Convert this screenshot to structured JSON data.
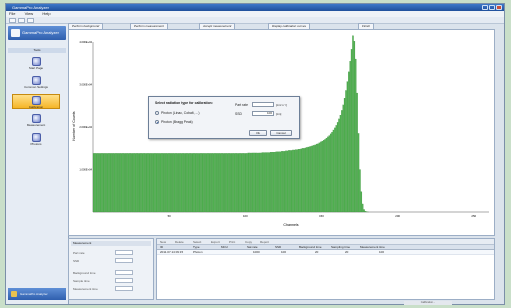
{
  "window": {
    "title": "GammaPro Analyzer"
  },
  "menu": [
    "File",
    "View",
    "Help"
  ],
  "sidebar": {
    "header": "GammaPro Analyzer",
    "tools_label": "Tools",
    "items": [
      {
        "label": "Start Page"
      },
      {
        "label": "Common Settings"
      },
      {
        "label": "Calibration"
      },
      {
        "label": "Measurement"
      },
      {
        "label": "Photons"
      }
    ],
    "active_index": 2,
    "footer": "GammaPro Analyzer"
  },
  "tabs": [
    "Perform background",
    "Perform measurement",
    "Accept measurement",
    "Display calibration curves",
    "Finish"
  ],
  "dialog": {
    "title": "Select radiation type for calibration:",
    "options": [
      "Photon (Linac, Cobalt, ...)",
      "Photon (Bragg Peak)"
    ],
    "selected_index": 1,
    "fields": [
      {
        "label": "Part rate",
        "value": "",
        "unit": "[cm² s⁻¹]"
      },
      {
        "label": "SSD",
        "value": "100",
        "unit": "[cm]"
      }
    ],
    "ok": "Ok",
    "cancel": "Cancel"
  },
  "chart_data": {
    "type": "bar",
    "ylabel": "Number of Counts",
    "xlabel": "Channels",
    "xlim": [
      0,
      260
    ],
    "x_ticks": [
      "50",
      "100",
      "150",
      "200",
      "250"
    ],
    "y_ticks": [
      "4.000E+04",
      "3.000E+04",
      "2.000E+04",
      "1.000E+04"
    ],
    "ylim": [
      0,
      40000
    ],
    "series": [
      {
        "values": [
          13800,
          13800,
          13800,
          13800,
          13800,
          13800,
          13800,
          13800,
          13800,
          13800,
          13800,
          13800,
          13800,
          13800,
          13800,
          13800,
          13800,
          13800,
          13800,
          13800,
          13800,
          13800,
          13800,
          13800,
          13800,
          13800,
          13800,
          13800,
          13800,
          13800,
          13800,
          13800,
          13800,
          13800,
          13800,
          13800,
          13800,
          13800,
          13800,
          13800,
          13800,
          13800,
          13800,
          13800,
          13800,
          13800,
          13800,
          13800,
          13800,
          13800,
          13800,
          13800,
          13800,
          13800,
          13800,
          13800,
          13800,
          13800,
          13800,
          13800,
          13800,
          13800,
          13800,
          13800,
          13800,
          13800,
          13800,
          13800,
          13800,
          13800,
          13800,
          13800,
          13800,
          13800,
          13800,
          13800,
          13800,
          13800,
          13800,
          13800,
          13800,
          13800,
          13800,
          13800,
          13800,
          13800,
          13800,
          13800,
          13800,
          13800,
          13800,
          13800,
          13800,
          13800,
          13800,
          13800,
          13800,
          13800,
          13800,
          13800,
          13800,
          13800,
          13800,
          13800,
          13800,
          13800,
          13800,
          13800,
          13800,
          13800,
          13800,
          13900,
          13900,
          13900,
          13900,
          13900,
          13900,
          13900,
          13900,
          13900,
          13900,
          14000,
          14000,
          14000,
          14000,
          14000,
          14000,
          14100,
          14100,
          14100,
          14100,
          14200,
          14200,
          14200,
          14200,
          14300,
          14300,
          14300,
          14400,
          14400,
          14500,
          14500,
          14500,
          14600,
          14600,
          14700,
          14700,
          14800,
          14800,
          14900,
          15000,
          15000,
          15100,
          15200,
          15300,
          15400,
          15500,
          15600,
          15700,
          15800,
          16000,
          16100,
          16300,
          16500,
          16700,
          16900,
          17100,
          17400,
          17700,
          18000,
          18400,
          18800,
          19300,
          19800,
          20400,
          21100,
          21900,
          22800,
          23900,
          25200,
          26800,
          28600,
          30700,
          33000,
          35500,
          38300,
          41500,
          40200,
          36000,
          28000,
          18500,
          10000,
          4800,
          1900,
          600,
          200,
          50,
          10,
          0,
          0,
          0,
          0,
          0,
          0,
          0,
          0,
          0,
          0,
          0,
          0,
          0,
          0,
          0,
          0,
          0,
          0,
          0,
          0,
          0,
          0,
          0,
          0,
          0,
          0,
          0,
          0,
          0,
          0,
          0,
          0,
          0,
          0,
          0,
          0,
          0,
          0,
          0,
          0,
          0,
          0,
          0,
          0,
          0,
          0,
          0,
          0,
          0,
          0,
          0,
          0,
          0,
          0,
          0,
          0,
          0,
          0,
          0,
          0,
          0,
          0,
          0,
          0,
          0,
          0,
          0,
          0,
          0,
          0,
          0,
          0,
          0,
          0,
          0,
          0,
          0,
          0,
          0,
          0,
          0,
          0,
          0,
          0,
          0,
          0
        ]
      }
    ],
    "colors": {
      "bar": "#4fb04f",
      "bar_edge": "#2f7f2f"
    }
  },
  "left_panel": {
    "title": "Measurement",
    "rows": [
      "Part rate",
      "SSD",
      "Background time",
      "Sample time",
      "Measurement time"
    ]
  },
  "table": {
    "toolbar": [
      "New",
      "Delete",
      "Select",
      "Export",
      "Print",
      "Copy",
      "Report"
    ],
    "columns": [
      "ID",
      "Type",
      "MCU",
      "Sat rate",
      "SSD",
      "Background time",
      "Sampling time",
      "Measurement time"
    ],
    "rows": [
      [
        "2011.07.14 09:15",
        "Photon",
        "",
        "1000",
        "100",
        "20",
        "20",
        "100"
      ]
    ]
  },
  "status": "Calibration..."
}
